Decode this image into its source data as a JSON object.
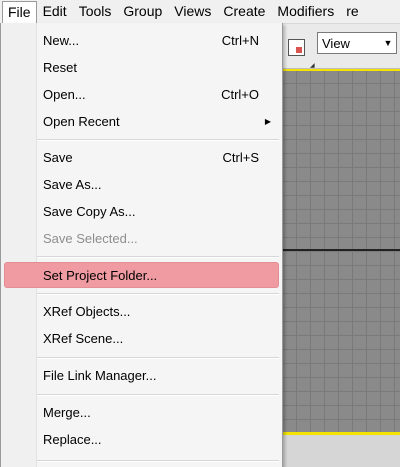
{
  "menubar": {
    "items": [
      "File",
      "Edit",
      "Tools",
      "Group",
      "Views",
      "Create",
      "Modifiers",
      "re"
    ]
  },
  "viewport_toolbar": {
    "view_select_value": "View"
  },
  "file_menu": {
    "items": [
      {
        "label": "New...",
        "shortcut": "Ctrl+N"
      },
      {
        "label": "Reset",
        "shortcut": ""
      },
      {
        "label": "Open...",
        "shortcut": "Ctrl+O"
      },
      {
        "label": "Open Recent",
        "shortcut": ""
      },
      {
        "label": "Save",
        "shortcut": "Ctrl+S"
      },
      {
        "label": "Save As...",
        "shortcut": ""
      },
      {
        "label": "Save Copy As...",
        "shortcut": ""
      },
      {
        "label": "Save Selected...",
        "shortcut": "",
        "disabled": true
      },
      {
        "label": "Set Project Folder...",
        "shortcut": "",
        "highlighted": true
      },
      {
        "label": "XRef Objects...",
        "shortcut": ""
      },
      {
        "label": "XRef Scene...",
        "shortcut": ""
      },
      {
        "label": "File Link Manager...",
        "shortcut": ""
      },
      {
        "label": "Merge...",
        "shortcut": ""
      },
      {
        "label": "Replace...",
        "shortcut": ""
      }
    ],
    "highlight_color": "#f09aa1"
  }
}
